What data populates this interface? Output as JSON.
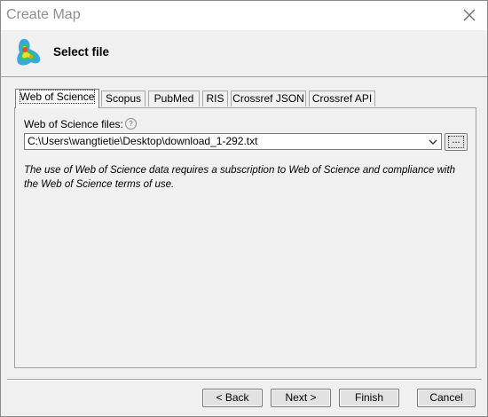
{
  "window": {
    "title": "Create Map"
  },
  "header": {
    "title": "Select file",
    "icon": "density-map-icon"
  },
  "tabs": [
    {
      "label": "Web of Science",
      "active": true
    },
    {
      "label": "Scopus",
      "active": false
    },
    {
      "label": "PubMed",
      "active": false
    },
    {
      "label": "RIS",
      "active": false
    },
    {
      "label": "Crossref JSON",
      "active": false
    },
    {
      "label": "Crossref API",
      "active": false
    }
  ],
  "panel": {
    "field_label": "Web of Science files:",
    "help_glyph": "?",
    "file_path": "C:\\Users\\wangtietie\\Desktop\\download_1-292.txt",
    "browse_label": "...",
    "notice": "The use of Web of Science data requires a subscription to Web of Science and compliance with the Web of Science terms of use."
  },
  "buttons": {
    "back": "< Back",
    "next": "Next >",
    "finish": "Finish",
    "cancel": "Cancel"
  },
  "colors": {
    "dialog_bg": "#f0f0f0",
    "title_text": "#8e8e8e",
    "border": "#a0a0a0"
  }
}
